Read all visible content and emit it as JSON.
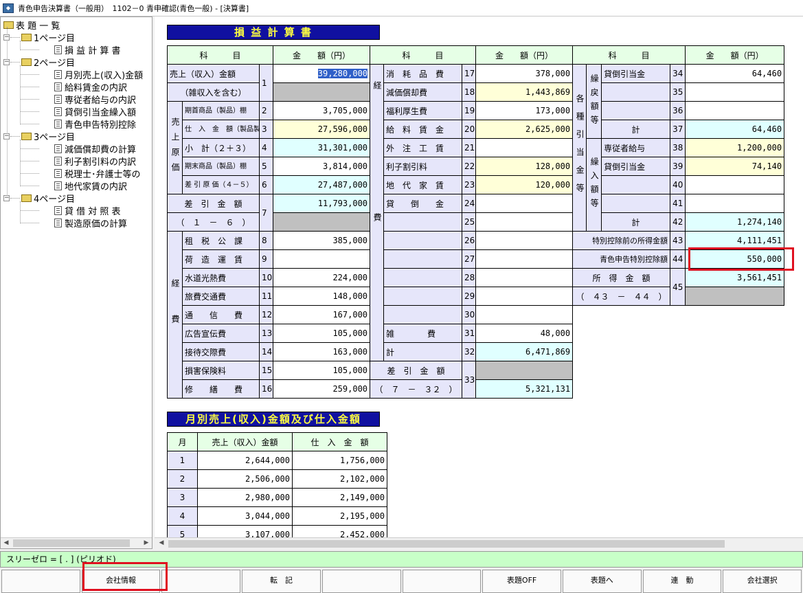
{
  "window": {
    "title": "青色申告決算書（一般用）　1102－0 青申確認(青色一般) - [決算書]"
  },
  "tree": {
    "root": "表 題 一 覧",
    "groups": [
      {
        "label": "1ページ目",
        "items": [
          "損 益 計 算 書"
        ]
      },
      {
        "label": "2ページ目",
        "items": [
          "月別売上(収入)金額",
          "給料賃金の内訳",
          "専従者給与の内訳",
          "貸倒引当金繰入額",
          "青色申告特別控除"
        ]
      },
      {
        "label": "3ページ目",
        "items": [
          "減価償却費の計算",
          "利子割引料の内訳",
          "税理士･弁護士等の",
          "地代家賃の内訳"
        ]
      },
      {
        "label": "4ページ目",
        "items": [
          "貸 借 対 照 表",
          "製造原価の計算"
        ]
      }
    ]
  },
  "pl": {
    "title": "損 益 計 算 書",
    "hdr_item": "科　　　目",
    "hdr_amount": "金　　額（円）",
    "sales": "売上（収入）金額",
    "sales_note": "（雑収入を含む）",
    "sales_val": "39,280,000",
    "cogs_group": "売上原価",
    "r2": "期首商品（製品）棚　　卸　　高",
    "r2v": "3,705,000",
    "r3": "仕　入　金　額（製品製造原価）",
    "r3v": "27,596,000",
    "r4": "小　計（２＋３）",
    "r4v": "31,301,000",
    "r5": "期末商品（製品）棚　　卸　　高",
    "r5v": "3,814,000",
    "r6": "差 引 原 価（４－５）",
    "r6v": "27,487,000",
    "r7": "差　引　金　額",
    "r7n": "（　１　－　６　）",
    "r7v": "11,793,000",
    "exp_group": "経費",
    "exp_left": [
      {
        "n": "8",
        "label": "租　税　公　課",
        "v": "385,000"
      },
      {
        "n": "9",
        "label": "荷　造　運　賃",
        "v": ""
      },
      {
        "n": "10",
        "label": "水道光熱費",
        "v": "224,000"
      },
      {
        "n": "11",
        "label": "旅費交通費",
        "v": "148,000"
      },
      {
        "n": "12",
        "label": "通　　信　　費",
        "v": "167,000"
      },
      {
        "n": "13",
        "label": "広告宣伝費",
        "v": "105,000"
      },
      {
        "n": "14",
        "label": "接待交際費",
        "v": "163,000"
      },
      {
        "n": "15",
        "label": "損害保険料",
        "v": "105,000"
      },
      {
        "n": "16",
        "label": "修　　繕　　費",
        "v": "259,000"
      }
    ],
    "exp_mid": [
      {
        "n": "17",
        "label": "消　耗　品　費",
        "v": "378,000"
      },
      {
        "n": "18",
        "label": "減価償却費",
        "v": "1,443,869"
      },
      {
        "n": "19",
        "label": "福利厚生費",
        "v": "173,000"
      },
      {
        "n": "20",
        "label": "給　料　賃　金",
        "v": "2,625,000"
      },
      {
        "n": "21",
        "label": "外　注　工　賃",
        "v": ""
      },
      {
        "n": "22",
        "label": "利子割引料",
        "v": "128,000"
      },
      {
        "n": "23",
        "label": "地　代　家　賃",
        "v": "120,000"
      },
      {
        "n": "24",
        "label": "貸　　倒　　金",
        "v": ""
      },
      {
        "n": "25",
        "label": "",
        "v": ""
      },
      {
        "n": "26",
        "label": "",
        "v": ""
      },
      {
        "n": "27",
        "label": "",
        "v": ""
      },
      {
        "n": "28",
        "label": "",
        "v": ""
      },
      {
        "n": "29",
        "label": "",
        "v": ""
      },
      {
        "n": "30",
        "label": "",
        "v": ""
      },
      {
        "n": "31",
        "label": "雑　　　　費",
        "v": "48,000"
      },
      {
        "n": "32",
        "label": "計",
        "v": "6,471,869"
      }
    ],
    "r33": "差　引　金　額",
    "r33n": "（　７　－　３２　）",
    "r33v": "5,321,131",
    "rev_group": "各種引当金等",
    "rev_sub1": "繰戻額等",
    "rev_sub2": "繰入額等",
    "r34": "貸倒引当金",
    "r34v": "64,460",
    "r37": "計",
    "r37v": "64,460",
    "r38": "専従者給与",
    "r38v": "1,200,000",
    "r39": "貸倒引当金",
    "r39v": "74,140",
    "r42": "計",
    "r42v": "1,274,140",
    "r43": "特別控除前の所得金額",
    "r43v": "4,111,451",
    "r44": "青色申告特別控除額",
    "r44v": "550,000",
    "r45": "所　得　金　額",
    "r45n": "（　４３　－　４４　）",
    "r45v": "3,561,451",
    "nums": {
      "n1": "1",
      "n2": "2",
      "n3": "3",
      "n4": "4",
      "n5": "5",
      "n6": "6",
      "n7": "7",
      "n33": "33",
      "n34": "34",
      "n35": "35",
      "n36": "36",
      "n37": "37",
      "n38": "38",
      "n39": "39",
      "n40": "40",
      "n41": "41",
      "n42": "42",
      "n43": "43",
      "n44": "44",
      "n45": "45"
    }
  },
  "monthly": {
    "title": "月別売上(収入)金額及び仕入金額",
    "h_month": "月",
    "h_sales": "売上（収入）金額",
    "h_purchase": "仕　入　金　額",
    "rows": [
      {
        "m": "1",
        "s": "2,644,000",
        "p": "1,756,000"
      },
      {
        "m": "2",
        "s": "2,506,000",
        "p": "2,102,000"
      },
      {
        "m": "3",
        "s": "2,980,000",
        "p": "2,149,000"
      },
      {
        "m": "4",
        "s": "3,044,000",
        "p": "2,195,000"
      },
      {
        "m": "5",
        "s": "3,107,000",
        "p": "2,452,000"
      }
    ]
  },
  "status": "スリーゼロ = [ . ] (ピリオド)",
  "fkeys": [
    "",
    "会社情報",
    "",
    "転　記",
    "",
    "",
    "表題OFF",
    "表題へ",
    "連　動",
    "会社選択"
  ]
}
